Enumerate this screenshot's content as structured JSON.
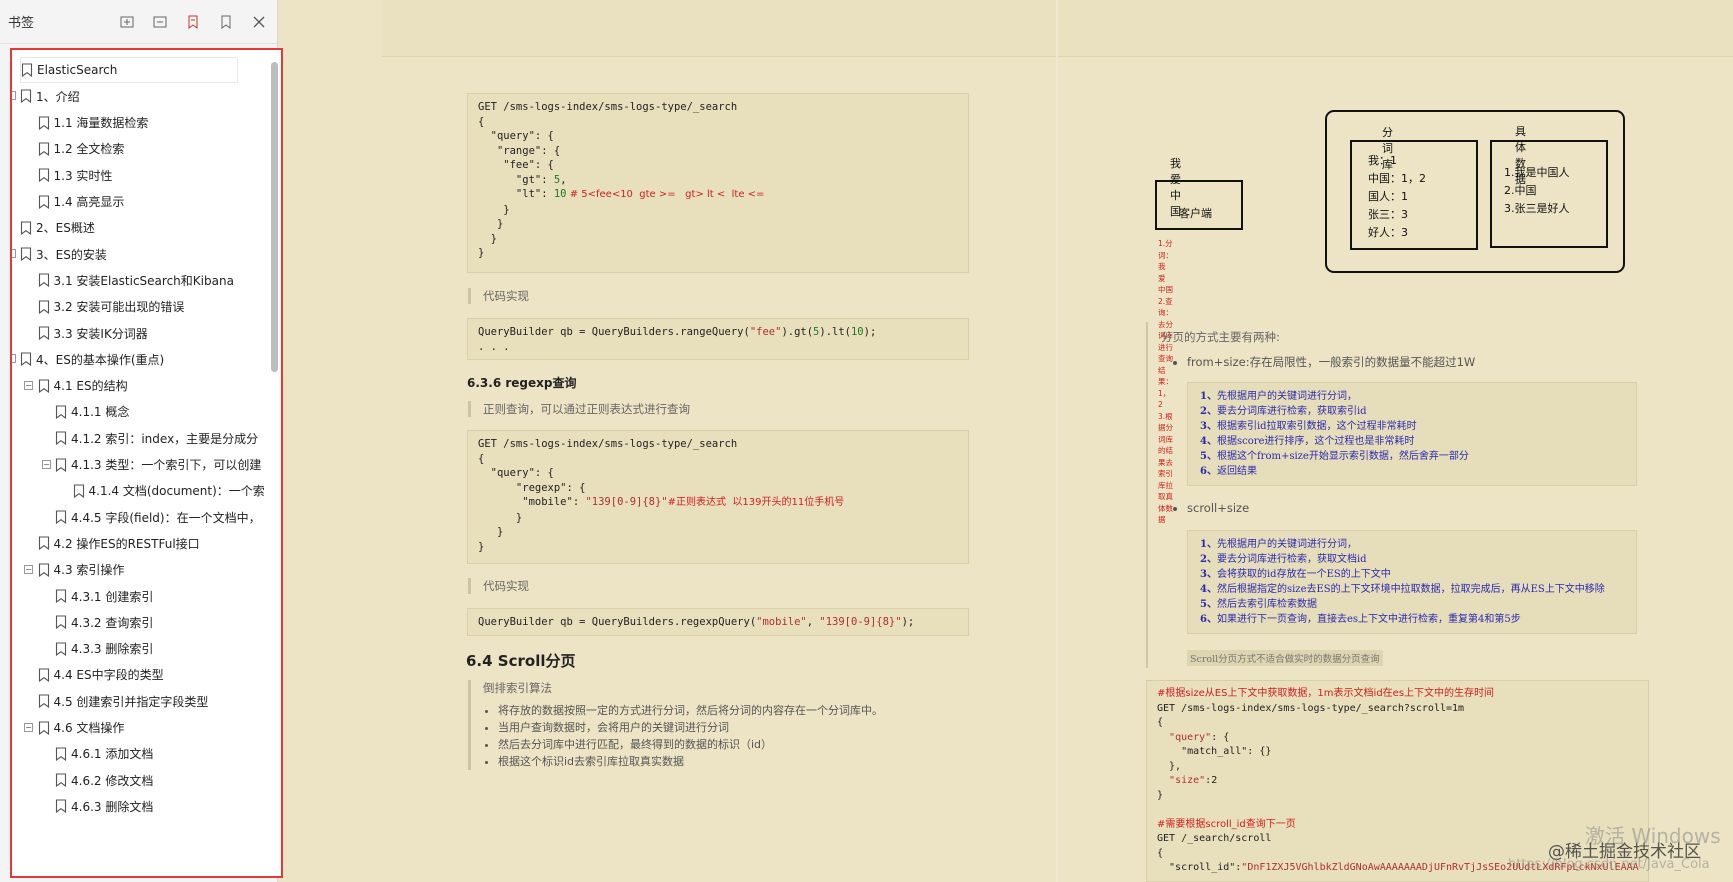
{
  "sidebar": {
    "title": "书签",
    "tools": [
      "expand-all-icon",
      "collapse-all-icon",
      "add-bookmark-icon",
      "bookmark-icon",
      "close-icon"
    ],
    "items": [
      {
        "label": "ElasticSearch"
      },
      {
        "label": "1、介绍"
      },
      {
        "label": "1.1 海量数据检索"
      },
      {
        "label": "1.2 全文检索"
      },
      {
        "label": "1.3 实时性"
      },
      {
        "label": "1.4 高亮显示"
      },
      {
        "label": "2、ES概述"
      },
      {
        "label": "3、ES的安装"
      },
      {
        "label": "3.1 安装ElasticSearch和Kibana"
      },
      {
        "label": "3.2 安装可能出现的错误"
      },
      {
        "label": "3.3 安装IK分词器"
      },
      {
        "label": "4、ES的基本操作(重点)"
      },
      {
        "label": "4.1 ES的结构"
      },
      {
        "label": "4.1.1 概念"
      },
      {
        "label": "4.1.2 索引：index，主要是分成分"
      },
      {
        "label": "4.1.3 类型：一个索引下，可以创建"
      },
      {
        "label": "4.1.4 文档(document)：一个索"
      },
      {
        "label": "4.4.5 字段(field)：在一个文档中，"
      },
      {
        "label": "4.2 操作ES的RESTFul接口"
      },
      {
        "label": "4.3 索引操作"
      },
      {
        "label": "4.3.1 创建索引"
      },
      {
        "label": "4.3.2 查询索引"
      },
      {
        "label": "4.3.3 删除索引"
      },
      {
        "label": "4.4 ES中字段的类型"
      },
      {
        "label": "4.5 创建索引并指定字段类型"
      },
      {
        "label": "4.6 文档操作"
      },
      {
        "label": "4.6.1 添加文档"
      },
      {
        "label": "4.6.2 修改文档"
      },
      {
        "label": "4.6.3 删除文档"
      }
    ]
  },
  "left_page": {
    "code1": {
      "line1_method": "GET",
      "line1_path": " /sms-logs-index/sms-logs-type/_search",
      "body_a": "{\n  \"query\": {\n   \"range\": {\n    \"fee\": {\n      \"gt\": ",
      "gt_val": "5",
      "body_b": ",\n      \"lt\": ",
      "lt_val": "10",
      "lt_comment": " # 5<fee<10  gte >=   gt> lt <  lte <=",
      "body_c": "\n    }\n   }\n  }\n}"
    },
    "quote1": "代码实现",
    "code2": {
      "pre": "QueryBuilder qb = QueryBuilders.rangeQuery(",
      "arg": "\"fee\"",
      "post1": ").gt(",
      "n1": "5",
      "post2": ").lt(",
      "n2": "10",
      "post3": ");",
      "ellipsis": ". . ."
    },
    "h_regexp": "6.3.6 regexp查询",
    "quote2": "正则查询，可以通过正则表达式进行查询",
    "code3": {
      "line1_method": "GET",
      "line1_path": " /sms-logs-index/sms-logs-type/_search",
      "body_a": "{\n  \"query\": {\n      \"regexp\": {\n       \"mobile\": ",
      "regex": "\"139[0-9]{8}\"",
      "comment": "#正则表达式  以139开头的11位手机号",
      "body_b": "\n      }\n   }\n}"
    },
    "quote3": "代码实现",
    "code4": {
      "pre": "QueryBuilder qb = QueryBuilders.regexpQuery(",
      "a1": "\"mobile\"",
      "sep": ", ",
      "a2": "\"139[0-9]{8}\"",
      "post": ");"
    },
    "h_scroll": "6.4 Scroll分页",
    "quote4_title": "倒排索引算法",
    "quote4_items": [
      "将存放的数据按照一定的方式进行分词，然后将分词的内容存在一个分词库中。",
      "当用户查询数据时，会将用户的关键词进行分词",
      "然后去分词库中进行匹配，最终得到的数据的标识（id）",
      "根据这个标识id去索引库拉取真实数据"
    ]
  },
  "right_page": {
    "diagram": {
      "user_label": "我爱中国",
      "client_label": "客户端",
      "notes": [
        "1.分词：我  爱  中国",
        "2.查询：去分词库进行查询",
        "   结果：1，2",
        "3.根据分词库的结果去索引库拉取真体数据"
      ],
      "dict_title": "分词库",
      "dict_lines": [
        "我：1",
        "中国：1，2",
        "国人：1",
        "张三：3",
        "好人：3"
      ],
      "data_title": "具体数据",
      "data_lines": [
        "1.我是中国人",
        "2.中国",
        "3.张三是好人"
      ]
    },
    "paging_intro": "分页的方式主要有两种:",
    "fromsize_label": "from+size:存在局限性，一般索引的数据量不能超过1W",
    "fromsize_steps": [
      {
        "n": "1、",
        "t": "先根据用户的关键词进行分词，"
      },
      {
        "n": "2、",
        "t": "要去分词库进行检索，获取索引id"
      },
      {
        "n": "3、",
        "t": "根据索引id拉取索引数据，这个过程非常耗时"
      },
      {
        "n": "4、",
        "t": "根据score进行排序，这个过程也是非常耗时"
      },
      {
        "n": "5、",
        "t": "根据这个from+size开始显示索引数据，然后舍弃一部分"
      },
      {
        "n": "6、",
        "t": "返回结果"
      }
    ],
    "scroll_label": "scroll+size",
    "scroll_steps": [
      {
        "n": "1、",
        "t": "先根据用户的关键词进行分词，"
      },
      {
        "n": "2、",
        "t": "要去分词库进行检索，获取文档id"
      },
      {
        "n": "3、",
        "t": "会将获取的id存放在一个ES的上下文中"
      },
      {
        "n": "4、",
        "t": "然后根据指定的size去ES的上下文环境中拉取数据，拉取完成后，再从ES上下文中移除"
      },
      {
        "n": "5、",
        "t": "然后去索引库检索数据"
      },
      {
        "n": "6、",
        "t": "如果进行下一页查询，直接去es上下文中进行检索，重复第4和第5步"
      }
    ],
    "scroll_note": "Scroll分页方式不适合做实时的数据分页查询",
    "code5": {
      "comment1": "#根据size从ES上下文中获取数据，1m表示文档id在es上下文中的生存时间",
      "line1": "GET /sms-logs-index/sms-logs-type/_search?scroll=1m",
      "body_a": "{\n  ",
      "k_query": "\"query\"",
      "body_b": ": {\n    \"match_all\": {}\n  },\n  ",
      "k_size": "\"size\"",
      "body_c": ":2\n}",
      "comment2": "#需要根据scroll_id查询下一页",
      "line2": "GET /_search/scroll",
      "body_d": "{\n  \"scroll_id\":",
      "scroll_val": "\"DnF1ZXJ5VGhlbkZldGNoAwAAAAAAADjUFnRvTjJsSEo2UUdtLXdRFpLckNxUlEAAA"
    },
    "watermark_windows": "激活 Windows",
    "watermark_juejin": "@稀土掘金技术社区",
    "watermark_url": "https://blog.csdn.net/Java_Cola"
  }
}
